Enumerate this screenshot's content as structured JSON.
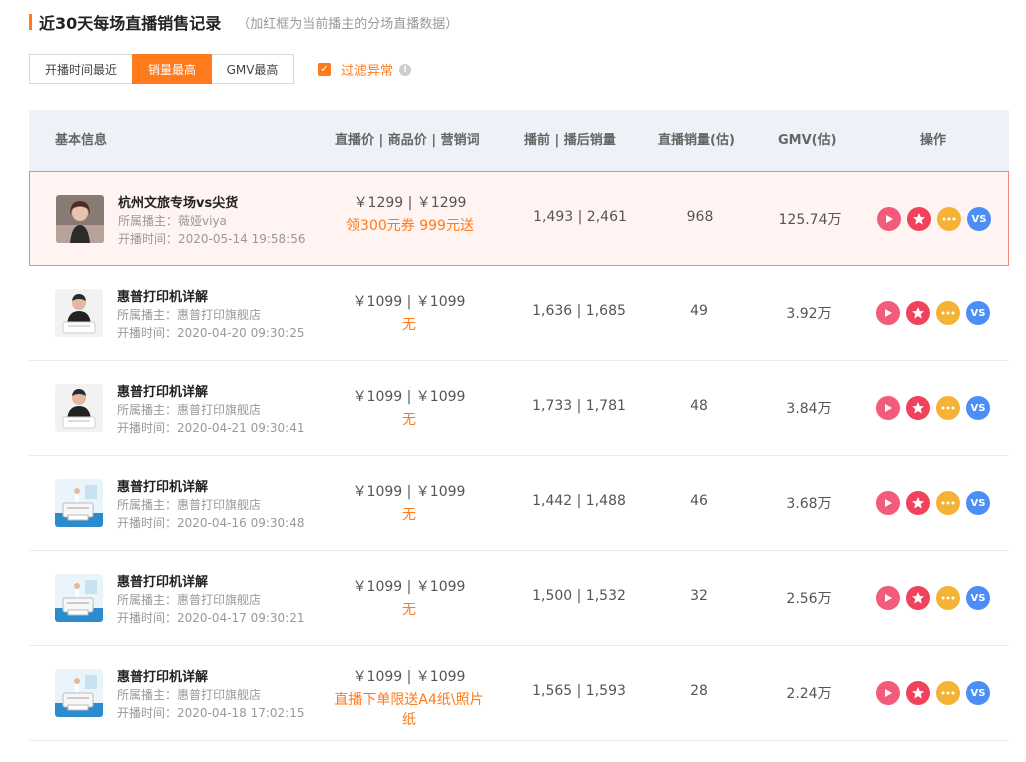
{
  "section": {
    "title": "近30天每场直播销售记录",
    "subtitle": "（加红框为当前播主的分场直播数据）"
  },
  "sort_tabs": [
    {
      "label": "开播时间最近",
      "active": false
    },
    {
      "label": "销量最高",
      "active": true
    },
    {
      "label": "GMV最高",
      "active": false
    }
  ],
  "filter": {
    "label": "过滤异常",
    "checked": true
  },
  "table": {
    "headers": {
      "basic": "基本信息",
      "price": "直播价 | 商品价 | 营销词",
      "sales": "播前 | 播后销量",
      "live_sales": "直播销量(估)",
      "gmv": "GMV(估)",
      "ops": "操作"
    },
    "owner_label": "所属播主：",
    "time_label": "开播时间：",
    "rows": [
      {
        "title": "杭州文旅专场vs尖货",
        "owner": "薇娅viya",
        "time": "2020-05-14 19:58:56",
        "price": "￥1299 | ￥1299",
        "promo": "领300元券 999元送",
        "sales": "1,493 | 2,461",
        "live_sales": "968",
        "gmv": "125.74万",
        "highlight": true,
        "thumb": "person-woman"
      },
      {
        "title": "惠普打印机详解",
        "owner": "惠普打印旗舰店",
        "time": "2020-04-20 09:30:25",
        "price": "￥1099 | ￥1099",
        "promo": "无",
        "sales": "1,636 | 1,685",
        "live_sales": "49",
        "gmv": "3.92万",
        "highlight": false,
        "thumb": "person-printer"
      },
      {
        "title": "惠普打印机详解",
        "owner": "惠普打印旗舰店",
        "time": "2020-04-21 09:30:41",
        "price": "￥1099 | ￥1099",
        "promo": "无",
        "sales": "1,733 | 1,781",
        "live_sales": "48",
        "gmv": "3.84万",
        "highlight": false,
        "thumb": "person-printer"
      },
      {
        "title": "惠普打印机详解",
        "owner": "惠普打印旗舰店",
        "time": "2020-04-16 09:30:48",
        "price": "￥1099 | ￥1099",
        "promo": "无",
        "sales": "1,442 | 1,488",
        "live_sales": "46",
        "gmv": "3.68万",
        "highlight": false,
        "thumb": "printer-blue"
      },
      {
        "title": "惠普打印机详解",
        "owner": "惠普打印旗舰店",
        "time": "2020-04-17 09:30:21",
        "price": "￥1099 | ￥1099",
        "promo": "无",
        "sales": "1,500 | 1,532",
        "live_sales": "32",
        "gmv": "2.56万",
        "highlight": false,
        "thumb": "printer-blue"
      },
      {
        "title": "惠普打印机详解",
        "owner": "惠普打印旗舰店",
        "time": "2020-04-18 17:02:15",
        "price": "￥1099 | ￥1099",
        "promo": "直播下单限送A4纸\\照片纸",
        "sales": "1,565 | 1,593",
        "live_sales": "28",
        "gmv": "2.24万",
        "highlight": false,
        "thumb": "printer-blue"
      }
    ]
  },
  "actions": [
    {
      "name": "play-icon",
      "kind": "play"
    },
    {
      "name": "star-icon",
      "kind": "star"
    },
    {
      "name": "more-icon",
      "kind": "more"
    },
    {
      "name": "vs-icon",
      "kind": "vs",
      "label": "VS"
    }
  ],
  "colors": {
    "accent": "#ff7a1a",
    "highlight_border": "#f08a80",
    "highlight_bg": "#fff4f2",
    "header_bg": "#eef2f8"
  }
}
